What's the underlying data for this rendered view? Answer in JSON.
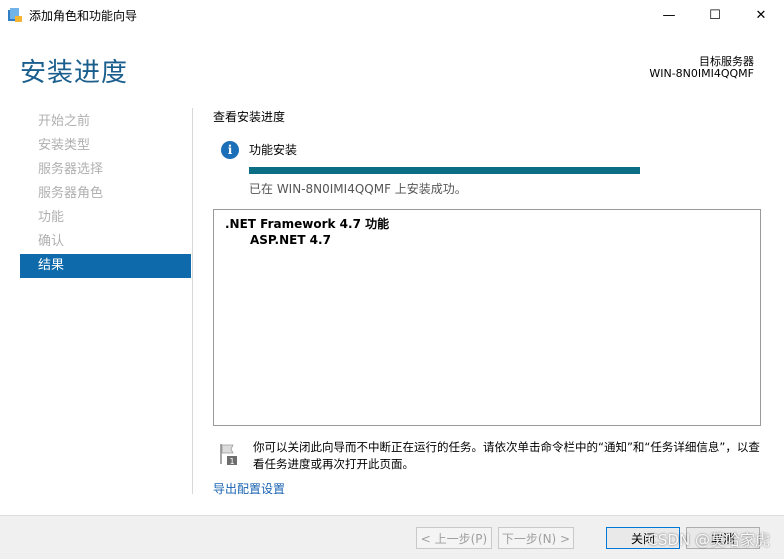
{
  "window": {
    "title": "添加角色和功能向导",
    "minimize_glyph": "—",
    "maximize_glyph": "☐",
    "close_glyph": "✕"
  },
  "header": {
    "page_title": "安装进度",
    "server_label": "目标服务器",
    "server_name": "WIN-8N0IMI4QQMF"
  },
  "sidebar": {
    "items": [
      {
        "label": "开始之前",
        "active": false
      },
      {
        "label": "安装类型",
        "active": false
      },
      {
        "label": "服务器选择",
        "active": false
      },
      {
        "label": "服务器角色",
        "active": false
      },
      {
        "label": "功能",
        "active": false
      },
      {
        "label": "确认",
        "active": false
      },
      {
        "label": "结果",
        "active": true
      }
    ]
  },
  "main": {
    "section_title": "查看安装进度",
    "progress_title": "功能安装",
    "progress_percent": 100,
    "status_text": "已在 WIN-8N0IMI4QQMF 上安装成功。",
    "results": {
      "feature": ".NET Framework 4.7 功能",
      "sub_feature": "ASP.NET 4.7"
    },
    "note_text": "你可以关闭此向导而不中断正在运行的任务。请依次单击命令栏中的“通知”和“任务详细信息”，以查看任务进度或再次打开此页面。",
    "export_link": "导出配置设置"
  },
  "footer": {
    "prev_button": "< 上一步(P)",
    "next_button": "下一步(N) >",
    "close_button": "关闭",
    "cancel_button": "取消"
  },
  "watermark": "CSDN @莫哈家虎",
  "colors": {
    "accent": "#0e6aab",
    "progress": "#0c6e84",
    "title": "#1a5e8d",
    "link": "#1a64b2"
  }
}
